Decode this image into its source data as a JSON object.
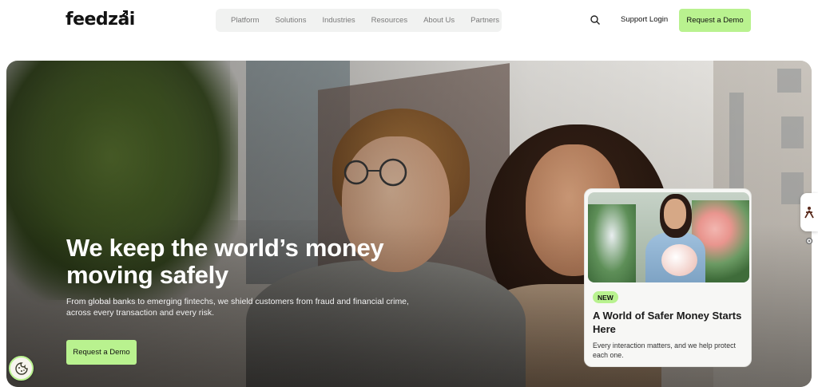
{
  "header": {
    "logo": "feedzai",
    "nav": [
      "Platform",
      "Solutions",
      "Industries",
      "Resources",
      "About Us",
      "Partners"
    ],
    "support_login": "Support Login",
    "request_demo": "Request a Demo"
  },
  "hero": {
    "title": "We keep the world’s money moving safely",
    "subtitle": "From global banks to emerging fintechs, we shield customers from fraud and financial crime, across every transaction and every risk.",
    "cta": "Request a Demo"
  },
  "card": {
    "badge": "NEW",
    "title": "A World of Safer Money Starts Here",
    "description": "Every interaction matters, and we help protect each one."
  },
  "colors": {
    "accent": "#b9f28f",
    "nav_bg": "#f1f2f1",
    "text_dark": "#111111"
  },
  "icons": {
    "search": "search-icon",
    "cookie": "cookie-icon",
    "side_widget": "accessibility-icon",
    "gear": "gear-icon"
  }
}
